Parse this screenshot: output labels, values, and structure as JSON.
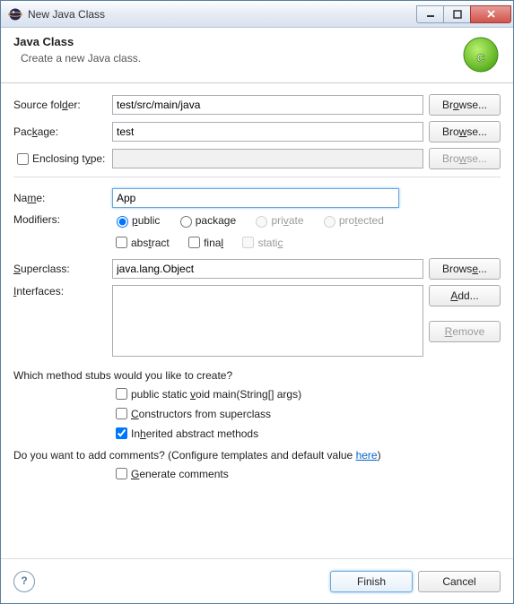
{
  "window": {
    "title": "New Java Class"
  },
  "banner": {
    "heading": "Java Class",
    "sub": "Create a new Java class."
  },
  "labels": {
    "sourceFolder": "Source folder:",
    "package": "Package:",
    "enclosing": "Enclosing type:",
    "name": "Name:",
    "modifiers": "Modifiers:",
    "superclass": "Superclass:",
    "interfaces": "Interfaces:",
    "stubsQ": "Which method stubs would you like to create?",
    "commentsQ_pre": "Do you want to add comments? (Configure templates and default value ",
    "commentsQ_link": "here",
    "commentsQ_post": ")"
  },
  "fields": {
    "sourceFolder": "test/src/main/java",
    "package": "test",
    "enclosing": "",
    "name": "App",
    "superclass": "java.lang.Object"
  },
  "modifiers": {
    "public": "public",
    "package": "package",
    "private": "private",
    "protected": "protected",
    "abstract": "abstract",
    "final": "final",
    "static": "static"
  },
  "stubs": {
    "main": "public static void main(String[] args)",
    "ctors": "Constructors from superclass",
    "inherited": "Inherited abstract methods"
  },
  "genComments": "Generate comments",
  "buttons": {
    "browse": "Browse...",
    "add": "Add...",
    "remove": "Remove",
    "finish": "Finish",
    "cancel": "Cancel"
  }
}
